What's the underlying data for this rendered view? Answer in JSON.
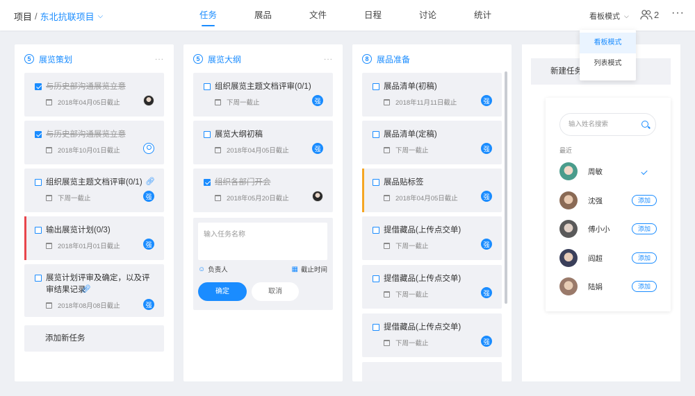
{
  "header": {
    "project_prefix": "项目",
    "separator": "/",
    "project_name": "东北抗联项目",
    "tabs": [
      {
        "label": "任务",
        "active": true
      },
      {
        "label": "展品",
        "active": false
      },
      {
        "label": "文件",
        "active": false
      },
      {
        "label": "日程",
        "active": false
      },
      {
        "label": "讨论",
        "active": false
      },
      {
        "label": "统计",
        "active": false
      }
    ],
    "view_mode_label": "看板模式",
    "member_count": "2",
    "more": "···",
    "accent_color": "#1a8cff"
  },
  "view_dropdown": {
    "options": [
      "看板模式",
      "列表模式"
    ],
    "selected": "看板模式"
  },
  "columns": [
    {
      "count": "5",
      "title": "展览策划",
      "more": "···",
      "cards": [
        {
          "title": "与历史部沟通展览立意",
          "done": true,
          "meta": "2018年04月05日截止",
          "avatar": "photo"
        },
        {
          "title": "与历史部沟通展览立意",
          "done": true,
          "meta": "2018年10月01日截止",
          "avatar": "user"
        },
        {
          "title": "组织展览主题文档评审(0/1)",
          "done": false,
          "meta": "下周一截止",
          "avatar": "强",
          "link": true
        },
        {
          "title": "输出展览计划(0/3)",
          "done": false,
          "meta": "2018年01月01日截止",
          "avatar": "强",
          "bar_color": "#e8454c"
        },
        {
          "title": "展览计划评审及确定，以及评审结果记录",
          "done": false,
          "meta": "2018年08月08日截止",
          "avatar": "强",
          "link": true
        }
      ],
      "add_label": "添加新任务"
    },
    {
      "count": "5",
      "title": "展览大纲",
      "more": "···",
      "cards": [
        {
          "title": "组织展览主题文档评审(0/1)",
          "done": false,
          "meta": "下周一截止",
          "avatar": "强"
        },
        {
          "title": "展览大纲初稿",
          "done": false,
          "meta": "2018年04月05日截止",
          "avatar": "强"
        },
        {
          "title": "组织各部门开会",
          "done": true,
          "meta": "2018年05月20日截止",
          "avatar": "photo"
        }
      ],
      "form": {
        "placeholder": "输入任务名称",
        "assignee_label": "负责人",
        "deadline_label": "截止时间",
        "confirm_label": "确定",
        "cancel_label": "取消"
      }
    },
    {
      "count": "8",
      "title": "展品准备",
      "more": "",
      "cards": [
        {
          "title": "展品清单(初稿)",
          "done": false,
          "meta": "2018年11月11日截止",
          "avatar": "强"
        },
        {
          "title": "展品清单(定稿)",
          "done": false,
          "meta": "下周一截止",
          "avatar": "强"
        },
        {
          "title": "展品贴标签",
          "done": false,
          "meta": "2018年04月05日截止",
          "avatar": "强",
          "bar_color": "#f5a623"
        },
        {
          "title": "提借藏品(上传点交单)",
          "done": false,
          "meta": "下周一截止",
          "avatar": "强"
        },
        {
          "title": "提借藏品(上传点交单)",
          "done": false,
          "meta": "下周一截止",
          "avatar": "强"
        },
        {
          "title": "提借藏品(上传点交单)",
          "done": false,
          "meta": "下周一截止",
          "avatar": "强"
        }
      ]
    }
  ],
  "new_task_column": {
    "label": "新建任务",
    "picker": {
      "search_placeholder": "输入姓名搜索",
      "recent_label": "最近",
      "add_label": "添加",
      "people": [
        {
          "name": "周敏",
          "selected": true,
          "avatar_color": "#4a9c8c"
        },
        {
          "name": "沈强",
          "selected": false,
          "avatar_color": "#8a6a55"
        },
        {
          "name": "傅小小",
          "selected": false,
          "avatar_color": "#5a5a5a"
        },
        {
          "name": "阎超",
          "selected": false,
          "avatar_color": "#3a3f5a"
        },
        {
          "name": "陆娟",
          "selected": false,
          "avatar_color": "#9a7a6a"
        }
      ]
    }
  }
}
